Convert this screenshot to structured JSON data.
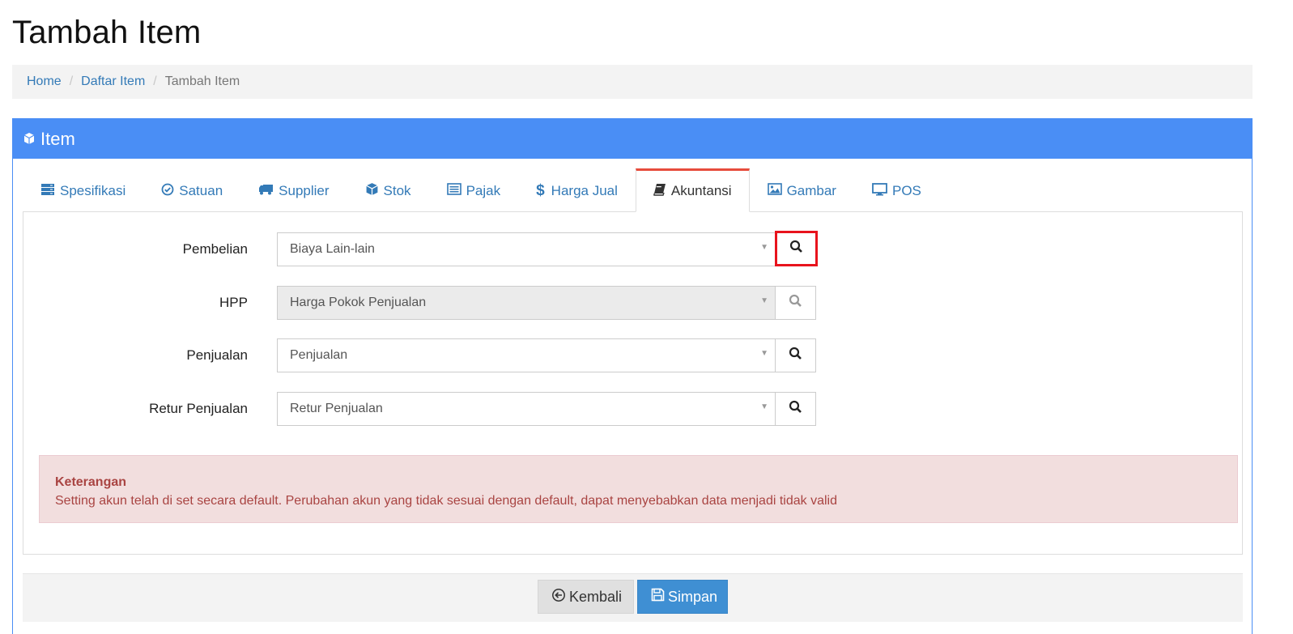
{
  "page": {
    "title": "Tambah Item"
  },
  "breadcrumb": [
    {
      "label": "Home"
    },
    {
      "label": "Daftar Item"
    },
    {
      "label": "Tambah Item"
    }
  ],
  "panel": {
    "title": "Item",
    "icon": "cube-icon"
  },
  "tabs": [
    {
      "label": "Spesifikasi",
      "icon": "server-icon"
    },
    {
      "label": "Satuan",
      "icon": "check-circle-icon"
    },
    {
      "label": "Supplier",
      "icon": "truck-icon"
    },
    {
      "label": "Stok",
      "icon": "cube-icon"
    },
    {
      "label": "Pajak",
      "icon": "list-alt-icon"
    },
    {
      "label": "Harga Jual",
      "icon": "dollar-icon"
    },
    {
      "label": "Akuntansi",
      "icon": "book-icon",
      "active": true
    },
    {
      "label": "Gambar",
      "icon": "image-icon"
    },
    {
      "label": "POS",
      "icon": "desktop-icon"
    }
  ],
  "form": {
    "fields": [
      {
        "label": "Pembelian",
        "value": "Biaya Lain-lain",
        "disabled": false
      },
      {
        "label": "HPP",
        "value": "Harga Pokok Penjualan",
        "disabled": true
      },
      {
        "label": "Penjualan",
        "value": "Penjualan",
        "disabled": false
      },
      {
        "label": "Retur Penjualan",
        "value": "Retur Penjualan",
        "disabled": false
      }
    ]
  },
  "alert": {
    "title": "Keterangan",
    "message": "Setting akun telah di set secara default. Perubahan akun yang tidak sesuai dengan default, dapat menyebabkan data menjadi tidak valid"
  },
  "buttons": {
    "back_label": "Kembali",
    "save_label": "Simpan"
  },
  "colors": {
    "primary": "#4a8ef5",
    "link": "#337ab7",
    "active_tab_border": "#e74c3c",
    "highlight": "#e8131d",
    "alert_bg": "#f2dede",
    "alert_text": "#a94442",
    "save_button": "#3f8fd3"
  }
}
